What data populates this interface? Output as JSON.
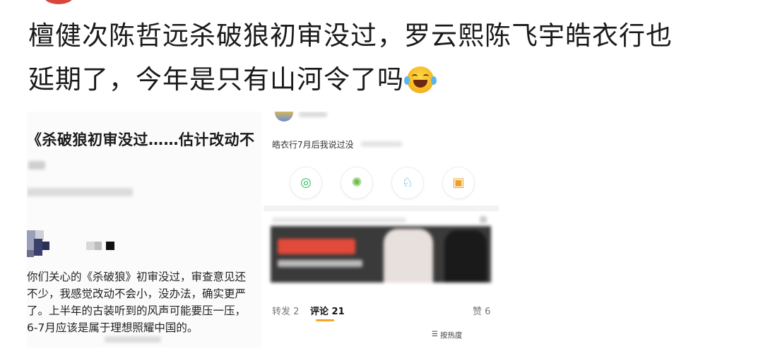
{
  "post": {
    "line1": "檀健次陈哲远杀破狼初审没过，罗云熙陈飞宇皓衣行也",
    "line2": "延期了，今年是只有山河令了吗",
    "emoji": "laugh-cry-emoji"
  },
  "left_screenshot": {
    "title": "《杀破狼初审没过……估计改动不",
    "body_lines": [
      "你们关心的《杀破狼》初审没过，审查意见还",
      "不少，我感觉改动不会小，没办法，确实更严",
      "了。上半年的古装听到的风声可能要压一压，",
      "6-7月应该是属于理想照耀中国的。"
    ]
  },
  "right_screenshot": {
    "comment": "皓衣行7月后我说过没",
    "share_icons": [
      "wechat-icon",
      "moments-icon",
      "qq-icon",
      "save-image-icon"
    ],
    "tabs": {
      "repost": "转发 2",
      "comments": "评论 21",
      "likes": "赞 6"
    },
    "sort_label": "按热度"
  }
}
